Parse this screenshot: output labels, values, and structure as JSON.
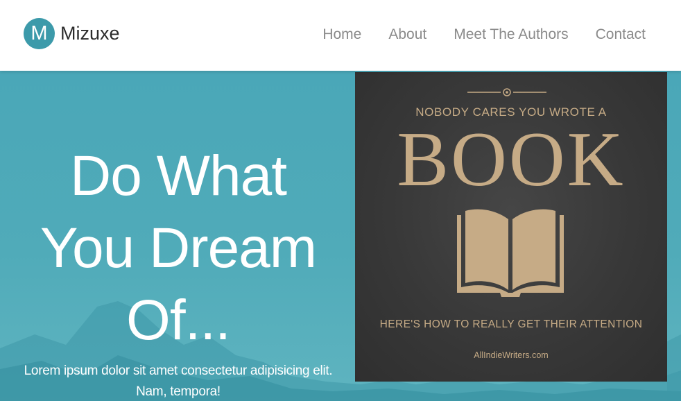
{
  "brand": {
    "logo_letter": "M",
    "name": "Mizuxe"
  },
  "nav": {
    "links": [
      {
        "label": "Home"
      },
      {
        "label": "About"
      },
      {
        "label": "Meet The Authors"
      },
      {
        "label": "Contact"
      }
    ]
  },
  "hero": {
    "headline_lines": [
      "Do What",
      "You Dream",
      "Of..."
    ],
    "subtext_lines": [
      "Lorem ipsum dolor sit amet consectetur adipisicing elit.",
      "Nam, tempora!"
    ]
  },
  "book_cover": {
    "top_line": "NOBODY CARES YOU WROTE A",
    "title": "BOOK",
    "tagline": "HERE'S HOW TO REALLY GET THEIR ATTENTION",
    "site": "AllIndieWriters.com"
  },
  "colors": {
    "brand_teal": "#3c9aaa",
    "hero_bg": "#4aa7b8",
    "cover_bg": "#383838",
    "cover_gold": "#c6ab86"
  }
}
